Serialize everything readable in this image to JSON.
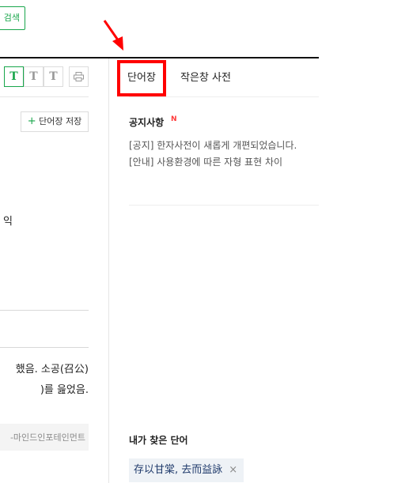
{
  "search": {
    "label": "검색"
  },
  "font_tools": {
    "t1": "T",
    "t2": "T",
    "t3": "T"
  },
  "left": {
    "save_label": "단어장 저장",
    "save_plus": "+",
    "fragment_ik": "익",
    "fragment_line1": "했음. 소공(召公)",
    "fragment_line2": ")를 읊었음.",
    "copyright": "-마인드인포테인먼트"
  },
  "tabs": [
    {
      "label": "단어장",
      "active": true
    },
    {
      "label": "작은창 사전",
      "active": false
    }
  ],
  "notice": {
    "title": "공지사항",
    "new_badge": "N",
    "items": [
      "[공지] 한자사전이 새롭게 개편되었습니다.",
      "[안내] 사용환경에 따른 자형 표현 차이"
    ]
  },
  "found_words": {
    "title": "내가 찾은 단어",
    "items": [
      {
        "text": "存以甘棠, 去而益詠",
        "close": "×"
      }
    ]
  },
  "colors": {
    "accent": "#19a64b",
    "highlight": "#ff0000",
    "chip_bg": "#eef2f6",
    "chip_text": "#1f3a6b"
  },
  "icons": {
    "print": "print-icon",
    "annotation": "red-arrow-icon"
  }
}
